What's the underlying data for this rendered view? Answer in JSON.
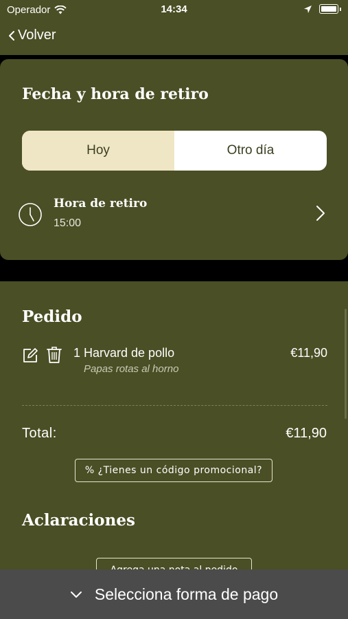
{
  "status_bar": {
    "carrier": "Operador",
    "time": "14:34"
  },
  "nav": {
    "back_label": "Volver"
  },
  "pickup": {
    "title": "Fecha y hora de retiro",
    "segments": [
      {
        "label": "Hoy",
        "selected": true
      },
      {
        "label": "Otro día",
        "selected": false
      }
    ],
    "time_label": "Hora de retiro",
    "time_value": "15:00"
  },
  "order": {
    "title": "Pedido",
    "items": [
      {
        "name": "1 Harvard de pollo",
        "note": "Papas rotas al horno",
        "price": "€11,90"
      }
    ],
    "total_label": "Total:",
    "total_value": "€11,90",
    "promo_label": "% ¿Tienes un código promocional?"
  },
  "notes": {
    "title": "Aclaraciones",
    "add_note_label": "Agrega una nota al pedido"
  },
  "footer": {
    "payment_label": "Selecciona forma de pago"
  },
  "colors": {
    "brand_green": "#4a4f25",
    "segment_active": "#efe6c6",
    "bottom_bar": "#4b4b4b"
  }
}
